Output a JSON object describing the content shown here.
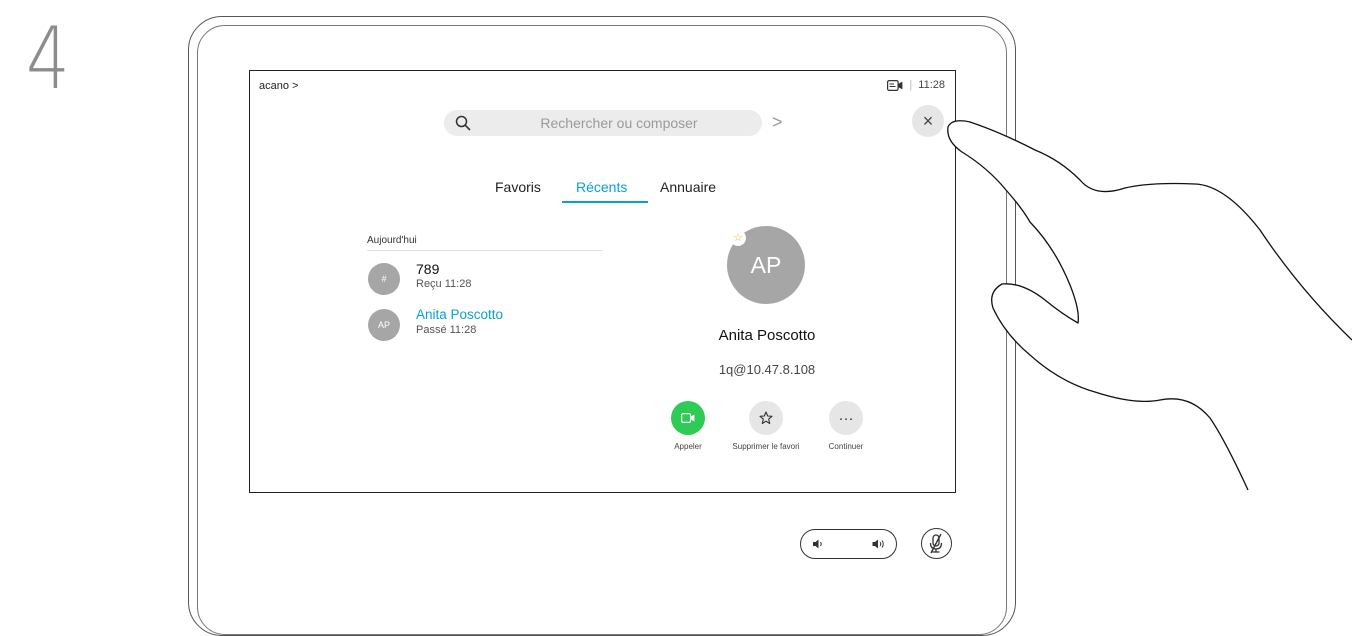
{
  "step": {
    "number": "4"
  },
  "header": {
    "breadcrumb": "acano >",
    "camera_icon": "camera-status-icon",
    "separator": "|",
    "time": "11:28"
  },
  "search": {
    "placeholder": "Rechercher ou composer",
    "go_label": ">"
  },
  "close_label": "×",
  "tabs": [
    {
      "label": "Favoris",
      "active": false
    },
    {
      "label": "Récents",
      "active": true
    },
    {
      "label": "Annuaire",
      "active": false
    }
  ],
  "recents": {
    "section_label": "Aujourd'hui",
    "items": [
      {
        "avatar": "#",
        "name": "789",
        "detail": "Reçu 11:28"
      },
      {
        "avatar": "AP",
        "name": "Anita Poscotto",
        "detail": "Passé 11:28"
      }
    ]
  },
  "contact": {
    "initials": "AP",
    "favorite_badge": "☆",
    "name": "Anita Poscotto",
    "address": "1q@10.47.8.108"
  },
  "actions": [
    {
      "label": "Appeler",
      "icon": "video-camera-icon",
      "color": "#2ecc55"
    },
    {
      "label": "Supprimer le favori",
      "icon": "star-icon"
    },
    {
      "label": "Continuer",
      "icon": "more-icon",
      "glyph": "···"
    }
  ],
  "colors": {
    "accent": "#07a2d3",
    "call_green": "#2ecc55",
    "avatar_gray": "#a6a6a6",
    "favorite_star": "#f2b521"
  }
}
